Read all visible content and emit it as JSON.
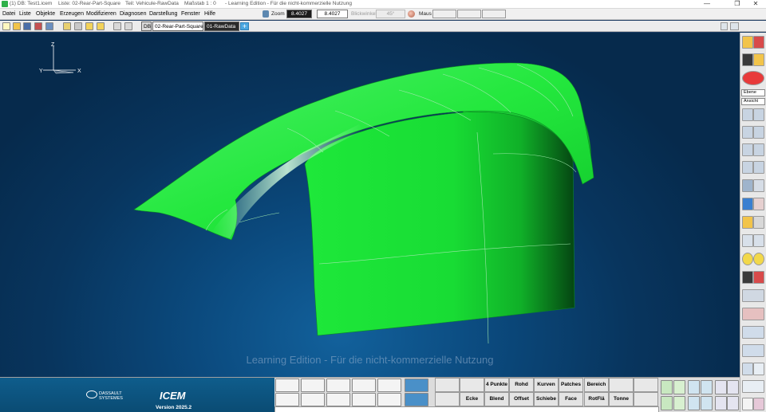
{
  "titlebar": {
    "title": "(1) DB: Test1.icem",
    "list": "Liste: 02-Rear-Part-Square",
    "part": "Teil: Vehicule-RawData",
    "scale": "Maßstab 1 : 0",
    "edition": "- Learning Edition - Für die nicht-kommerzielle Nutzung",
    "minimize": "—",
    "restore": "❐",
    "close": "✕"
  },
  "menu": {
    "datei": "Datei",
    "liste": "Liste",
    "objekte": "Objekte",
    "erzeugen": "Erzeugen",
    "modifizieren": "Modifizieren",
    "diagnosen": "Diagnosen",
    "darstellung": "Darstellung",
    "fenster": "Fenster",
    "hilfe": "Hilfe"
  },
  "statusbar": {
    "zoom_label": "Zoom",
    "zoom_value": "8.4027",
    "zoom_value2": "8.4027",
    "angle_label": "Blickwinkel",
    "angle_value": "45°",
    "mouse_label": "Maus"
  },
  "toolbar": {
    "db_label": "DB",
    "current_view": "02-Rear-Part-Square",
    "current_layer": "01-RawData",
    "add_symbol": "+"
  },
  "viewport": {
    "axes": {
      "z": "Z",
      "x": "X",
      "y": "Y"
    },
    "watermark": "Learning Edition - Für die nicht-kommerzielle Nutzung",
    "surface_color": "#1ee83a"
  },
  "sidebar": {
    "plane_select": "Ebene",
    "view_select": "Ansicht"
  },
  "brand": {
    "company_line1": "DASSAULT",
    "company_line2": "SYSTEMES",
    "product": "ICEM",
    "version": "Version 2025.2"
  },
  "commands": {
    "row1": [
      "",
      "",
      "4 Punkte",
      "Rohd",
      "Kurven",
      "Patches",
      "Bereich"
    ],
    "row2": [
      "",
      "Ecke",
      "Blend",
      "Offset",
      "Schiebe",
      "Face",
      "RotFlä",
      "Tonne"
    ]
  }
}
